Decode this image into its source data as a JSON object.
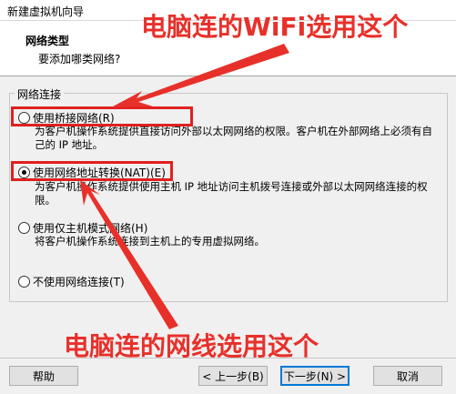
{
  "window": {
    "title": "新建虚拟机向导"
  },
  "header": {
    "title": "网络类型",
    "subtitle": "要添加哪类网络?"
  },
  "group": {
    "label": "网络连接"
  },
  "options": [
    {
      "label": "使用桥接网络(R)",
      "selected": false,
      "desc": "为客户机操作系统提供直接访问外部以太网网络的权限。客户机在外部网络上必须有自己的 IP 地址。"
    },
    {
      "label": "使用网络地址转换(NAT)(E)",
      "selected": true,
      "desc": "为客户机操作系统提供使用主机 IP 地址访问主机拨号连接或外部以太网网络连接的权限。"
    },
    {
      "label": "使用仅主机模式网络(H)",
      "selected": false,
      "desc": "将客户机操作系统连接到主机上的专用虚拟网络。"
    },
    {
      "label": "不使用网络连接(T)",
      "selected": false,
      "desc": ""
    }
  ],
  "annotations": {
    "top": "电脑连的WiFi选用这个",
    "bottom": "电脑连的网线选用这个",
    "color": "#e8302a"
  },
  "buttons": {
    "help": "帮助",
    "back": "< 上一步(B)",
    "next": "下一步(N) >",
    "cancel": "取消"
  }
}
